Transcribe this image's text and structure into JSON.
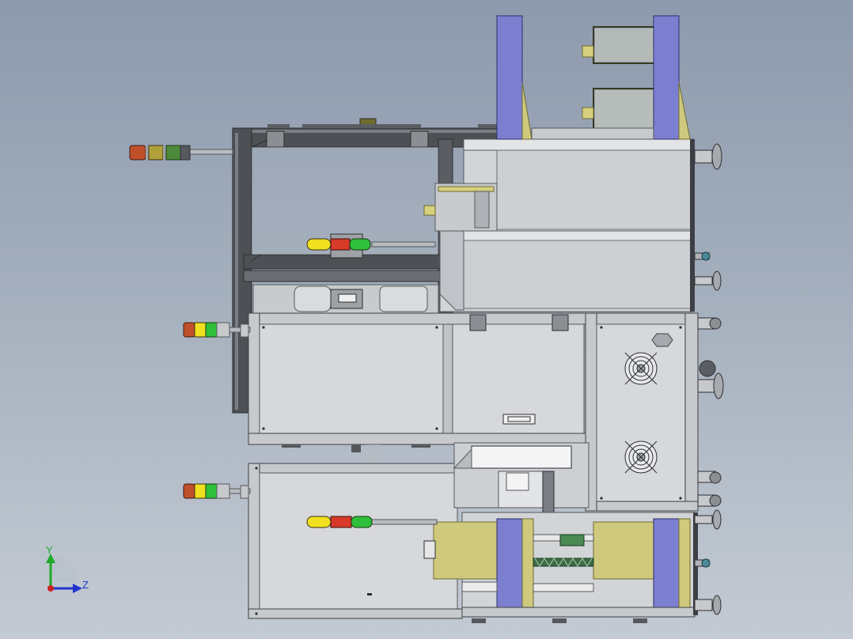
{
  "triad": {
    "y_label": "Y",
    "z_label": "Z",
    "y_color": "#1faa2a",
    "z_color": "#2233cc",
    "x_color": "#cc2222"
  },
  "colors": {
    "frame": "#4a4d52",
    "panel": "#d3d5d8",
    "panel_edge": "#55585c",
    "purple": "#7c7fd0",
    "khaki": "#cfc97e",
    "tower_red": "#d83a2a",
    "tower_yellow": "#f0e020",
    "tower_green": "#2fbf3a",
    "tower_orange": "#c0502a",
    "slate": "#59636e"
  }
}
